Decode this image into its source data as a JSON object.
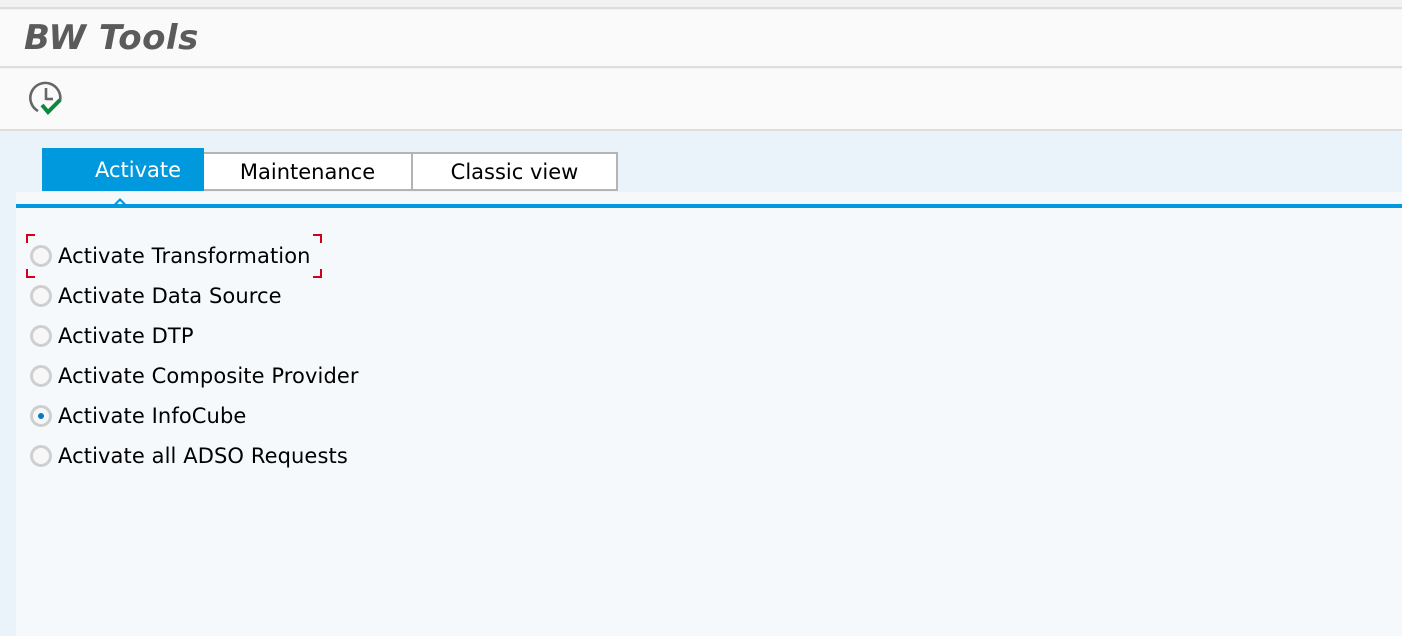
{
  "window": {
    "title": "BW Tools"
  },
  "toolbar": {
    "buttons": [
      {
        "icon": "clock-check-icon",
        "tooltip": ""
      }
    ]
  },
  "tabs": [
    {
      "label": "Activate",
      "active": true
    },
    {
      "label": "Maintenance",
      "active": false
    },
    {
      "label": "Classic view",
      "active": false
    }
  ],
  "options": {
    "items": [
      {
        "label": "Activate Transformation",
        "checked": false,
        "focused": true
      },
      {
        "label": "Activate Data Source",
        "checked": false,
        "focused": false
      },
      {
        "label": "Activate DTP",
        "checked": false,
        "focused": false
      },
      {
        "label": "Activate Composite Provider",
        "checked": false,
        "focused": false
      },
      {
        "label": "Activate InfoCube",
        "checked": true,
        "focused": false
      },
      {
        "label": "Activate all ADSO Requests",
        "checked": false,
        "focused": false
      }
    ]
  },
  "colors": {
    "accent": "#0099dd",
    "focus": "#d0021b",
    "check_green": "#0a8a3c"
  }
}
